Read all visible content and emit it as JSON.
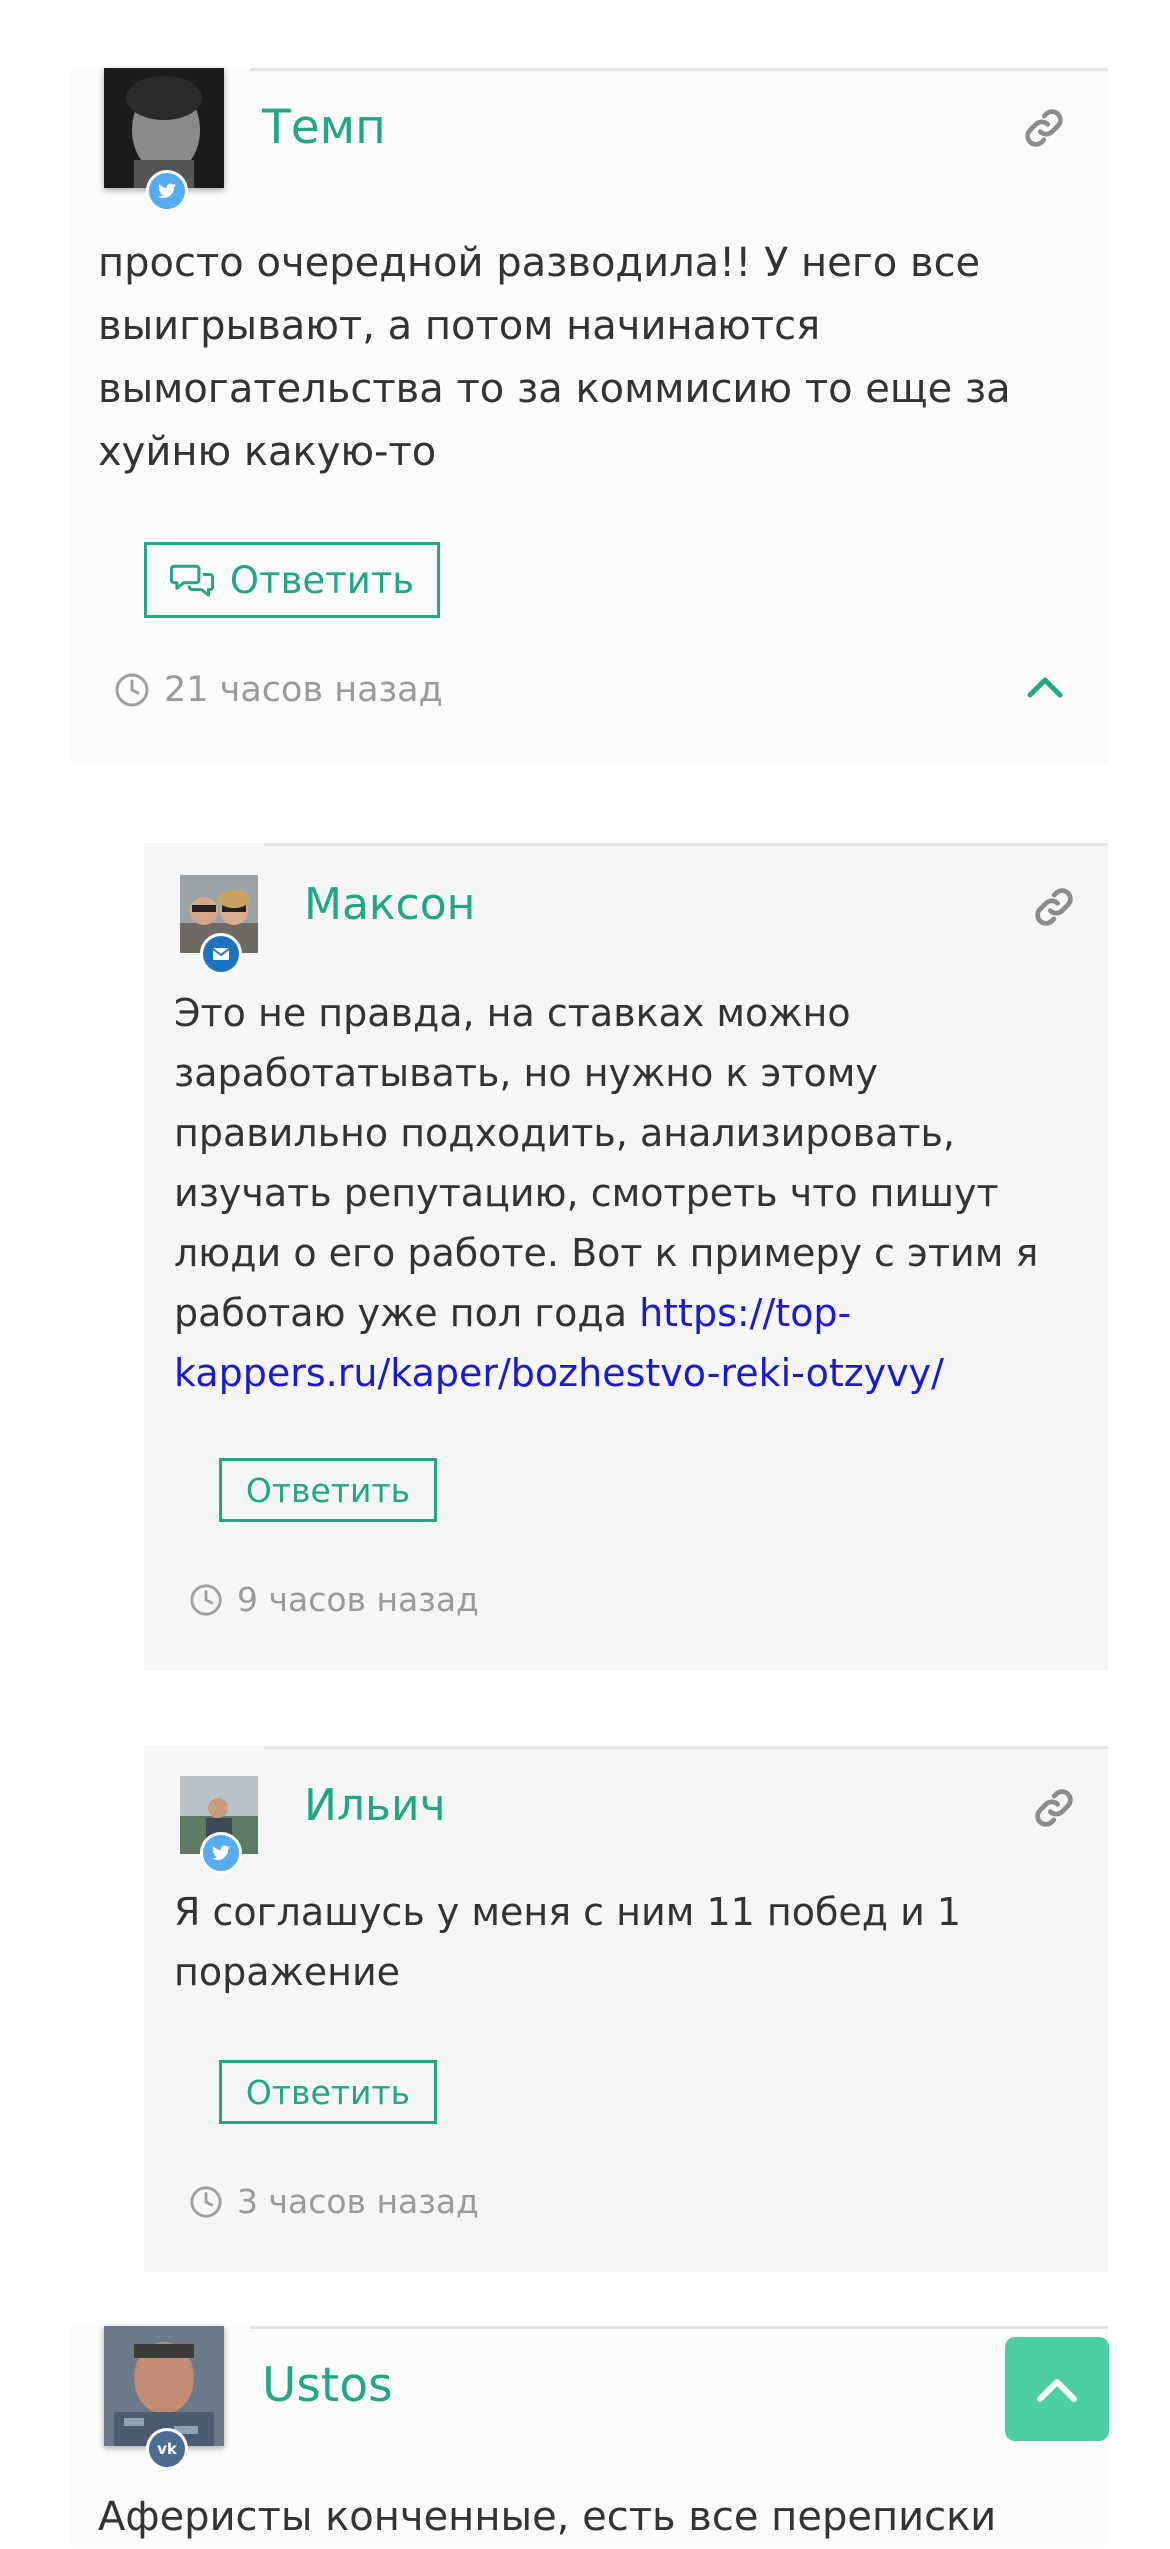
{
  "comments": [
    {
      "author": "Темп",
      "social": "twitter",
      "text": "просто очередной разводила!! У него все\nвыигрывают, а потом начинаются\nвымогательства то за коммисию то еще за\nхуйню какую-то",
      "reply_label": "Ответить",
      "time": "21 часов назад"
    },
    {
      "author": "Максон",
      "social": "email",
      "text": "Это не правда, на ставках можно\nзаработатывать, но нужно к этому\nправильно подходить, анализировать,\nизучать репутацию, смотреть что пишут\nлюди о его работе. Вот к примеру с этим я\nработаю уже пол года ",
      "link_text": "https://top-\nkappers.ru/kaper/bozhestvo-reki-otzyvy/",
      "reply_label": "Ответить",
      "time": "9 часов назад"
    },
    {
      "author": "Ильич",
      "social": "twitter",
      "text": "Я соглашусь у меня с ним 11 побед и 1\nпоражение",
      "reply_label": "Ответить",
      "time": "3 часов назад"
    },
    {
      "author": "Ustos",
      "social": "vk",
      "text": "Аферисты конченные, есть все переписки"
    }
  ],
  "colors": {
    "accent": "#20a885",
    "twitter": "#55acee",
    "email": "#1e73be",
    "vk": "#4c6c91",
    "scroll_button": "#4ccda3"
  },
  "icons": [
    "link-icon",
    "clock-icon",
    "chevron-up-icon",
    "comments-icon",
    "twitter-icon",
    "email-icon",
    "vk-icon",
    "arrow-up-icon"
  ]
}
